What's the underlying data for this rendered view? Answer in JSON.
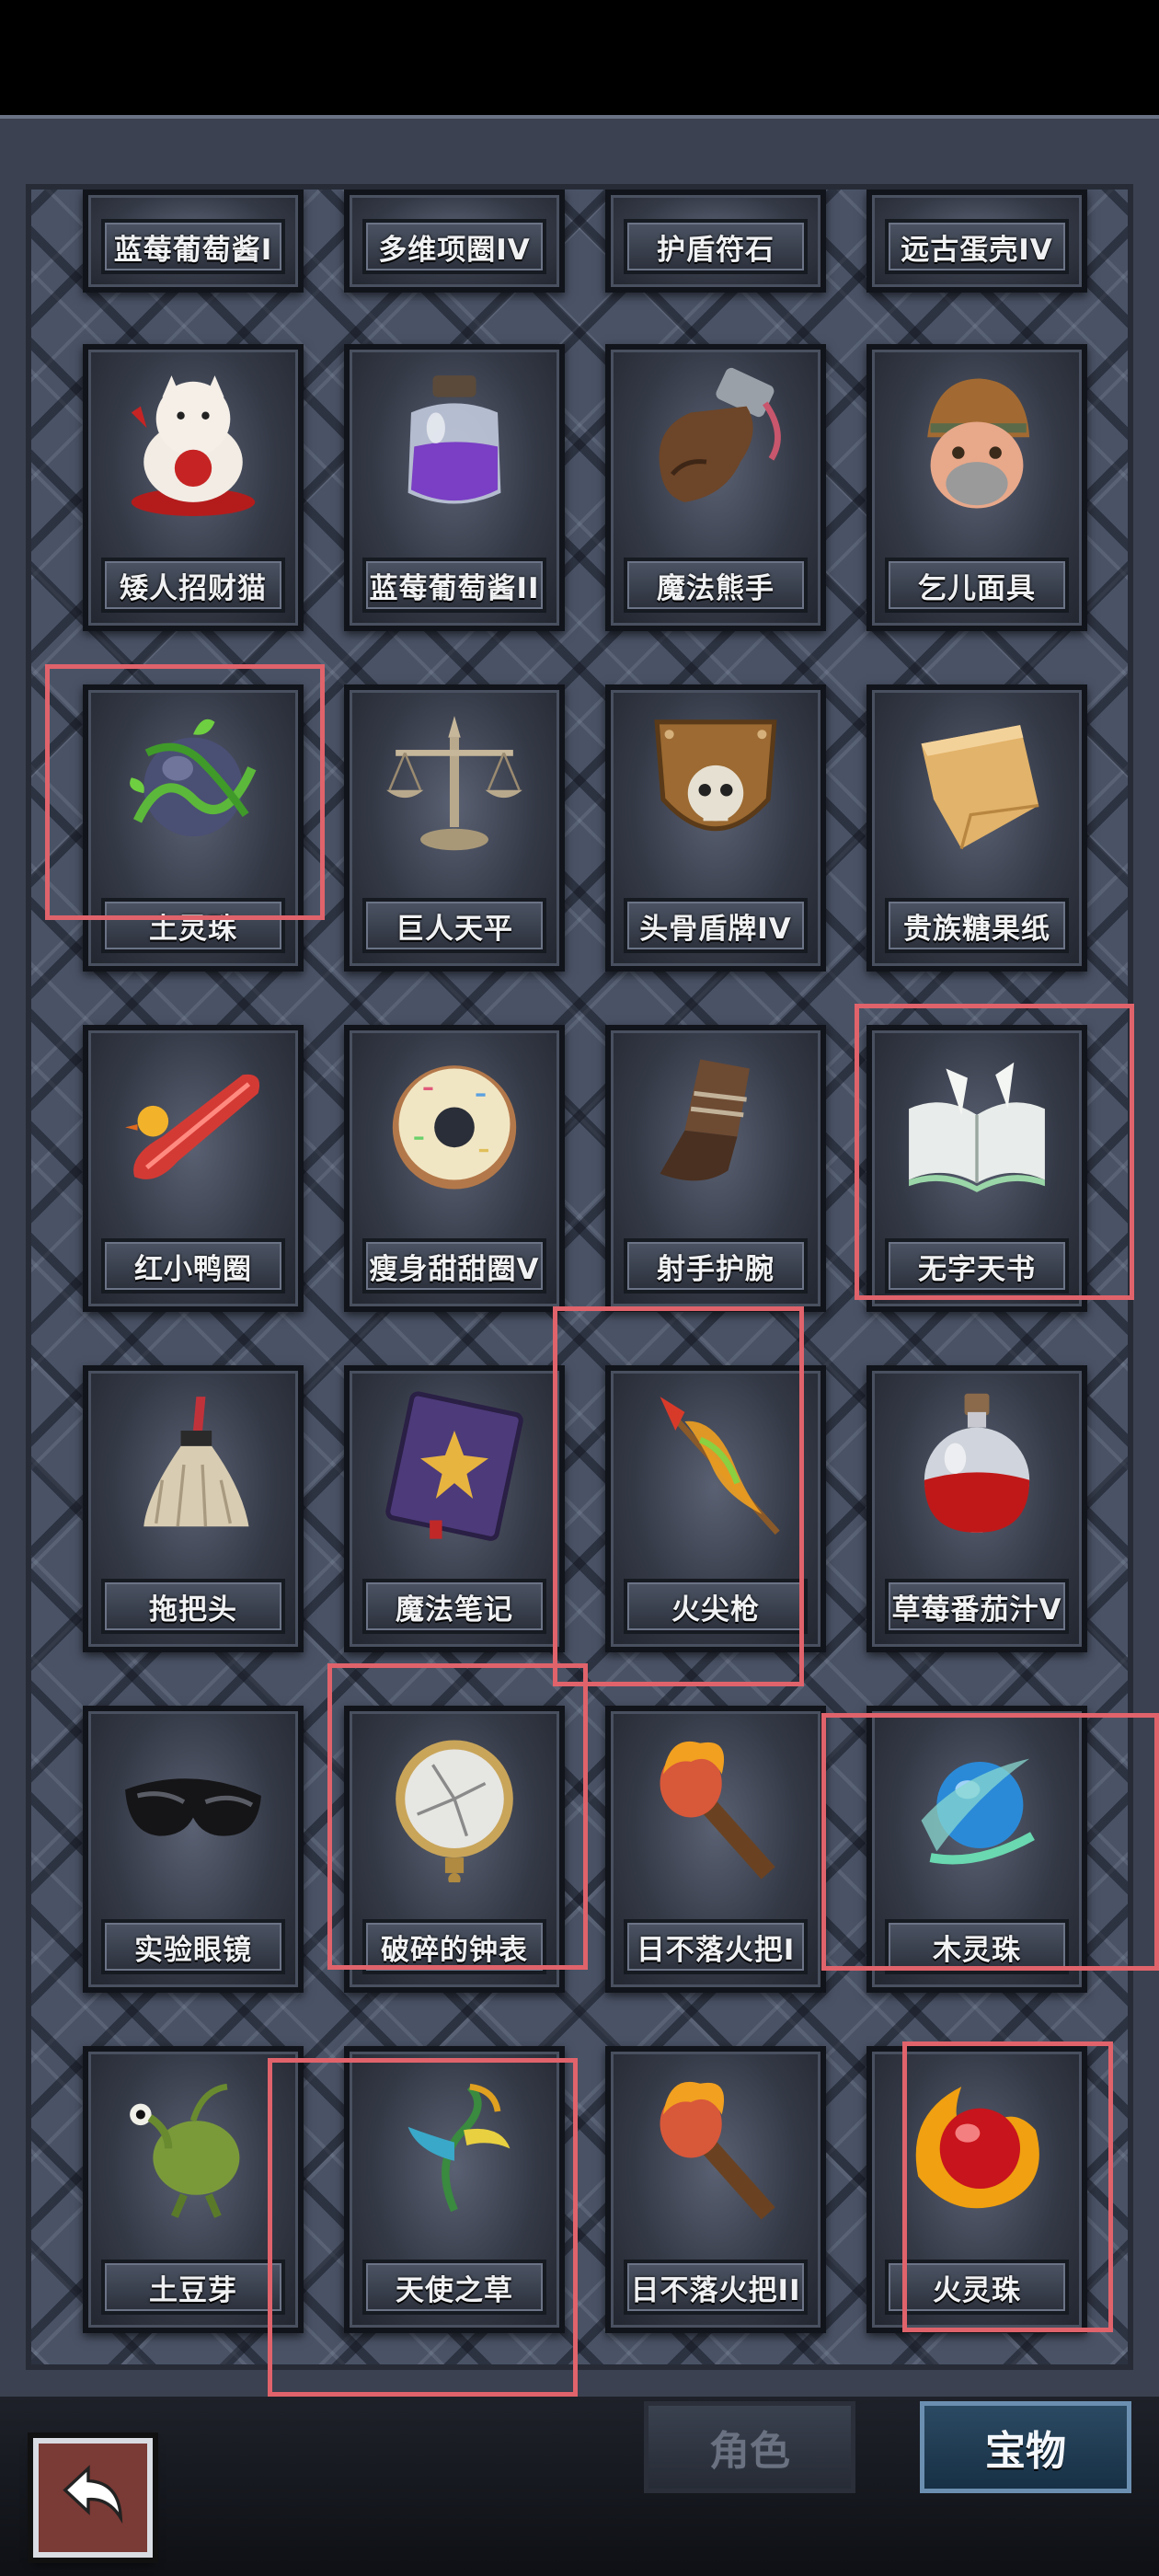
{
  "tabs": {
    "role": "角色",
    "treasure": "宝物"
  },
  "items": [
    "蓝莓葡萄酱I",
    "多维项圈IV",
    "护盾符石",
    "远古蛋壳IV",
    "矮人招财猫",
    "蓝莓葡萄酱II",
    "魔法熊手",
    "乞儿面具",
    "土灵珠",
    "巨人天平",
    "头骨盾牌IV",
    "贵族糖果纸",
    "红小鸭圈",
    "瘦身甜甜圈V",
    "射手护腕",
    "无字天书",
    "拖把头",
    "魔法笔记",
    "火尖枪",
    "草莓番茄汁V",
    "实验眼镜",
    "破碎的钟表",
    "日不落火把I",
    "木灵珠",
    "土豆芽",
    "天使之草",
    "日不落火把II",
    "火灵珠"
  ],
  "icons": [
    "jam-jar-icon",
    "collar-icon",
    "rune-stone-icon",
    "egg-shell-icon",
    "lucky-cat-icon",
    "potion-jar-icon",
    "bear-glove-icon",
    "beggar-mask-icon",
    "earth-orb-icon",
    "scale-icon",
    "skull-shield-icon",
    "candy-wrapper-icon",
    "duck-ring-icon",
    "donut-icon",
    "archer-bracer-icon",
    "blank-book-icon",
    "mop-head-icon",
    "magic-notebook-icon",
    "fire-spear-icon",
    "tomato-juice-icon",
    "goggles-icon",
    "broken-watch-icon",
    "torch-icon",
    "wood-orb-icon",
    "potato-sprout-icon",
    "angel-grass-icon",
    "torch-icon",
    "fire-orb-icon"
  ],
  "colors": {
    "highlight": "#e0636b",
    "back_button": "#7a3a35",
    "active_tab": "#2b4a63"
  }
}
